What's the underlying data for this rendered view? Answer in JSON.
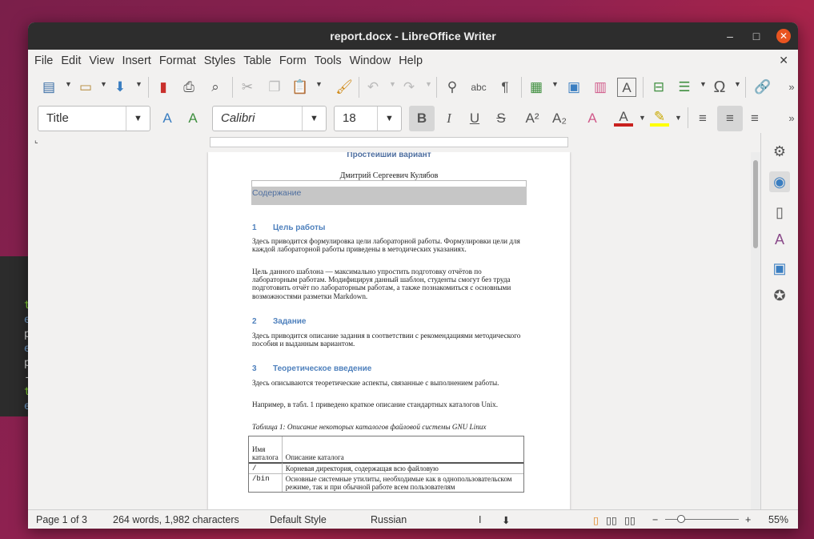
{
  "window": {
    "title": "report.docx - LibreOffice Writer"
  },
  "menu": [
    "File",
    "Edit",
    "View",
    "Insert",
    "Format",
    "Styles",
    "Table",
    "Form",
    "Tools",
    "Window",
    "Help"
  ],
  "format": {
    "style": "Title",
    "font": "Calibri",
    "size": "18"
  },
  "doc": {
    "title": "Простейший вариант",
    "author": "Дмитрий Сергеевич Кулябов",
    "toc": "Содержание",
    "s1_num": "1",
    "s1": "Цель работы",
    "p1": "Здесь приводится формулировка цели лабораторной работы. Формулировки цели для каждой лабораторной работы приведены в методических указаниях.",
    "p2": "Цель данного шаблона — максимально упростить подготовку отчётов по лабораторным работам. Модифицируя данный шаблон, студенты смогут без труда подготовить отчёт по лабораторным работам, а также познакомиться с основными возможностями разметки Markdown.",
    "s2_num": "2",
    "s2": "Задание",
    "p3": "Здесь приводится описание задания в соответствии с рекомендациями методического пособия и выданным вариантом.",
    "s3_num": "3",
    "s3": "Теоретическое введение",
    "p4": "Здесь описываются теоретические аспекты, связанные с выполнением работы.",
    "p5": "Например, в табл. 1 приведено краткое описание стандартных каталогов Unix.",
    "caption": "Таблица 1: Описание некоторых каталогов файловой системы GNU Linux",
    "table": {
      "h1": "Имя каталога",
      "h2": "Описание каталога",
      "r1c1": "/",
      "r1c2": "Корневая директория, содержащая всю файловую",
      "r2c1": "/bin",
      "r2c2": "Основные системные утилиты, необходимые как в однопользовательском режиме, так и при обычной работе всем пользователям"
    }
  },
  "status": {
    "page": "Page 1 of 3",
    "words": "264 words, 1,982 characters",
    "style": "Default Style",
    "lang": "Russian",
    "zoom": "55%"
  },
  "terminal": [
    "t",
    "e",
    "p",
    "e",
    "p",
    "-",
    "t",
    "e"
  ],
  "colors": {
    "accent": "#e95420",
    "heading": "#4f81bd"
  }
}
